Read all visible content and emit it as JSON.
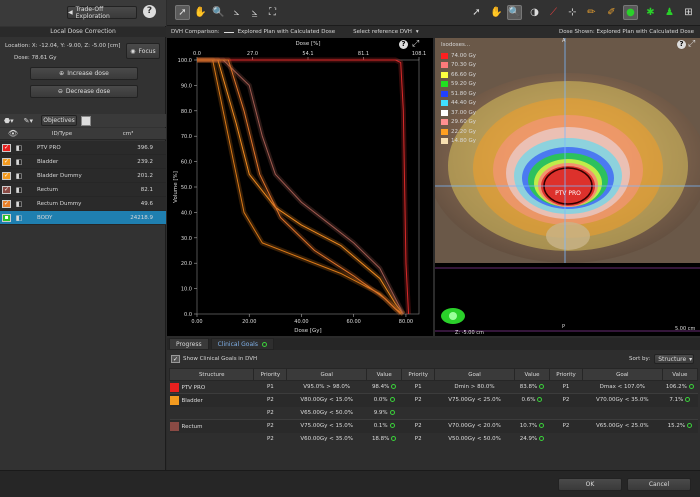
{
  "left_panel": {
    "back_label": "Trade-Off Exploration",
    "help": "?",
    "section_title": "Local Dose Correction",
    "location": "Location: X: -12.04, Y: -9.00, Z: -5.00 [cm]",
    "dose": "Dose: 78.61 Gy",
    "focus_label": "Focus",
    "increase_label": "Increase dose",
    "decrease_label": "Decrease dose",
    "objectives_tab": "Objectives",
    "col_id": "ID/Type",
    "col_unit": "cm³",
    "structures": [
      {
        "name": "PTV PRO",
        "volume": "396.9",
        "color": "#e8201e"
      },
      {
        "name": "Bladder",
        "volume": "239.2",
        "color": "#f39a1f"
      },
      {
        "name": "Bladder Dummy",
        "volume": "201.2",
        "color": "#f39a1f"
      },
      {
        "name": "Rectum",
        "volume": "82.1",
        "color": "#8a4a44"
      },
      {
        "name": "Rectum Dummy",
        "volume": "49.6",
        "color": "#e87f2a"
      },
      {
        "name": "BODY",
        "volume": "24218.9",
        "color": "#2ac42a"
      }
    ]
  },
  "dvh": {
    "comparison_label": "DVH Comparison:",
    "legend_text": "Explored Plan with Calculated Dose",
    "reference_label": "Select reference DVH",
    "top_axis_label": "Dose [%]",
    "top_ticks": [
      "0.0",
      "27.0",
      "54.1",
      "81.1",
      "108.1"
    ],
    "y_label": "Volume [%]",
    "y_ticks": [
      "100.0",
      "90.0",
      "80.0",
      "70.0",
      "60.0",
      "50.0",
      "40.0",
      "30.0",
      "20.0",
      "10.0",
      "0.0"
    ],
    "x_label": "Dose [Gy]",
    "x_ticks": [
      "0.00",
      "20.00",
      "40.00",
      "60.00",
      "80.00"
    ]
  },
  "image_view": {
    "dose_shown": "Dose Shown: Explored Plan with Calculated Dose",
    "isodoses_title": "Isodoses...",
    "isodoses": [
      {
        "label": "74.00 Gy",
        "color": "#ff2020"
      },
      {
        "label": "70.30 Gy",
        "color": "#ff7a7a"
      },
      {
        "label": "66.60 Gy",
        "color": "#ffff40"
      },
      {
        "label": "59.20 Gy",
        "color": "#20e020"
      },
      {
        "label": "51.80 Gy",
        "color": "#2040ff"
      },
      {
        "label": "44.40 Gy",
        "color": "#40e0ff"
      },
      {
        "label": "37.00 Gy",
        "color": "#ffffff"
      },
      {
        "label": "29.60 Gy",
        "color": "#ff9090"
      },
      {
        "label": "22.20 Gy",
        "color": "#ffa020"
      },
      {
        "label": "14.80 Gy",
        "color": "#f8e0b0"
      }
    ],
    "roi_label": "PTV PRO",
    "z_label": "Z: -5.00 cm",
    "scale_label": "5.00 cm",
    "marker_a": "A",
    "marker_p": "P"
  },
  "bottom": {
    "tab_progress": "Progress",
    "tab_clinical": "Clinical Goals",
    "show_goals_label": "Show Clinical Goals in DVH",
    "sort_label": "Sort by:",
    "sort_value": "Structure",
    "headers": [
      "Structure",
      "Priority",
      "Goal",
      "Value",
      "Priority",
      "Goal",
      "Value",
      "Priority",
      "Goal",
      "Value"
    ],
    "rows": [
      {
        "structure": "PTV PRO",
        "color": "#e8201e",
        "goals": [
          [
            "P1",
            "V95.0% > 98.0%",
            "98.4%"
          ],
          [
            "P1",
            "Dmin > 80.0%",
            "83.8%"
          ],
          [
            "P1",
            "Dmax < 107.0%",
            "106.2%"
          ]
        ]
      },
      {
        "structure": "Bladder",
        "color": "#f39a1f",
        "goals": [
          [
            "P2",
            "V80.00Gy < 15.0%",
            "0.0%"
          ],
          [
            "P2",
            "V75.00Gy < 25.0%",
            "0.6%"
          ],
          [
            "P2",
            "V70.00Gy < 35.0%",
            "7.1%"
          ]
        ]
      },
      {
        "structure": "",
        "color": "",
        "goals": [
          [
            "P2",
            "V65.00Gy < 50.0%",
            "9.9%"
          ],
          [
            "",
            "",
            ""
          ],
          [
            "",
            "",
            ""
          ]
        ]
      },
      {
        "structure": "Rectum",
        "color": "#8a4a44",
        "goals": [
          [
            "P2",
            "V75.00Gy < 15.0%",
            "0.1%"
          ],
          [
            "P2",
            "V70.00Gy < 20.0%",
            "10.7%"
          ],
          [
            "P2",
            "V65.00Gy < 25.0%",
            "15.2%"
          ]
        ]
      },
      {
        "structure": "",
        "color": "",
        "goals": [
          [
            "P2",
            "V60.00Gy < 35.0%",
            "18.8%"
          ],
          [
            "P2",
            "V50.00Gy < 50.0%",
            "24.9%"
          ],
          [
            "",
            "",
            ""
          ]
        ]
      }
    ],
    "ok_label": "OK",
    "cancel_label": "Cancel"
  },
  "chart_data": {
    "type": "line",
    "xlabel": "Dose [Gy]",
    "ylabel": "Volume [%]",
    "xlim": [
      0,
      85
    ],
    "ylim": [
      0,
      100
    ],
    "series": [
      {
        "name": "PTV PRO",
        "color": "#d82a2a",
        "x": [
          0,
          76,
          78,
          79,
          80,
          81
        ],
        "y": [
          100,
          100,
          99,
          80,
          20,
          0
        ]
      },
      {
        "name": "Bladder",
        "color": "#f08a20",
        "x": [
          0,
          8,
          15,
          20,
          30,
          40,
          55,
          70,
          76,
          79
        ],
        "y": [
          100,
          100,
          75,
          55,
          42,
          35,
          27,
          14,
          4,
          0
        ]
      },
      {
        "name": "Bladder Dummy",
        "color": "#d87818",
        "x": [
          0,
          6,
          12,
          18,
          25,
          40,
          55,
          70,
          76,
          79
        ],
        "y": [
          100,
          100,
          70,
          40,
          28,
          22,
          16,
          8,
          2,
          0
        ]
      },
      {
        "name": "Rectum",
        "color": "#a05a50",
        "x": [
          0,
          10,
          20,
          25,
          30,
          40,
          50,
          60,
          70,
          76,
          79
        ],
        "y": [
          100,
          100,
          90,
          70,
          55,
          44,
          36,
          28,
          18,
          6,
          0
        ]
      },
      {
        "name": "Rectum Dummy",
        "color": "#e0742a",
        "x": [
          0,
          12,
          18,
          24,
          32,
          45,
          60,
          72,
          78
        ],
        "y": [
          100,
          100,
          80,
          55,
          38,
          25,
          15,
          6,
          0
        ]
      }
    ]
  }
}
